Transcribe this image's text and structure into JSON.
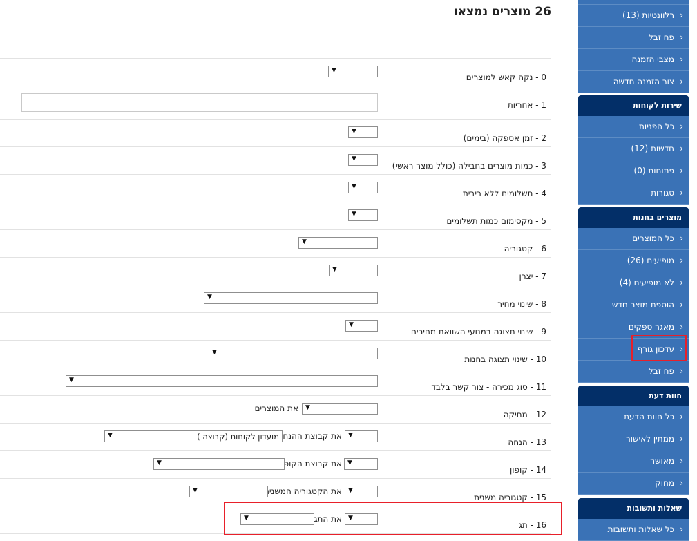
{
  "header": {
    "title": "26 מוצרים נמצאו"
  },
  "rows": [
    {
      "label": "0 - נקה קאש למוצרים"
    },
    {
      "label": "1 - אחריות"
    },
    {
      "label": "2 - זמן אספקה (בימים)"
    },
    {
      "label": "3 - כמות מוצרים בחבילה (כולל מוצר ראשי)"
    },
    {
      "label": "4 - תשלומים ללא ריבית"
    },
    {
      "label": "5 - מקסימום כמות תשלומים"
    },
    {
      "label": "6 - קטגוריה"
    },
    {
      "label": "7 - יצרן"
    },
    {
      "label": "8 - שינוי מחיר"
    },
    {
      "label": "9 - שינוי תצוגה במנועי השוואת מחירים"
    },
    {
      "label": "10 - שינוי תצוגה בחנות"
    },
    {
      "label": "11 - סוג מכירה - צור קשר בלבד"
    },
    {
      "label": "12 - מחיקה",
      "suffix": "את המוצרים"
    },
    {
      "label": "13 - הנחה",
      "suffix": "את קבוצת ההנחה",
      "second_value": "מועדון לקוחות (קבוצה )"
    },
    {
      "label": "14 - קופון",
      "suffix": "את קבוצת הקופון"
    },
    {
      "label": "15 - קטגוריה משנית",
      "suffix": "את הקטגוריה המשנית"
    },
    {
      "label": "16 - תג",
      "suffix": "את התג"
    }
  ],
  "sidebar": {
    "top_items": [
      "רלוונטיות (13)",
      "פח זבל",
      "מצבי הזמנה",
      "צור הזמנה חדשה"
    ],
    "customer_service": {
      "header": "שירות לקוחות",
      "items": [
        "כל הפניות",
        "חדשות (12)",
        "פתוחות (0)",
        "סגורות"
      ]
    },
    "store_products": {
      "header": "מוצרים בחנות",
      "items": [
        "כל המוצרים",
        "מופיעים (26)",
        "לא מופיעים (4)",
        "הוספת מוצר חדש",
        "מאגר ספקים",
        "עדכון גורף",
        "פח זבל"
      ]
    },
    "opinions": {
      "header": "חוות דעת",
      "items": [
        "כל חוות הדעת",
        "ממתין לאישור",
        "מאושר",
        "מחוק"
      ]
    },
    "qa": {
      "header": "שאלות ותשובות",
      "items": [
        "כל שאלות ותשובות"
      ]
    }
  },
  "icons": {
    "dropdown": "dropdown-arrow-icon",
    "chevron": "chevron-left-icon"
  },
  "colors": {
    "sidebar_item": "#3a72b6",
    "sidebar_header": "#032f68",
    "highlight": "#e8202a"
  }
}
